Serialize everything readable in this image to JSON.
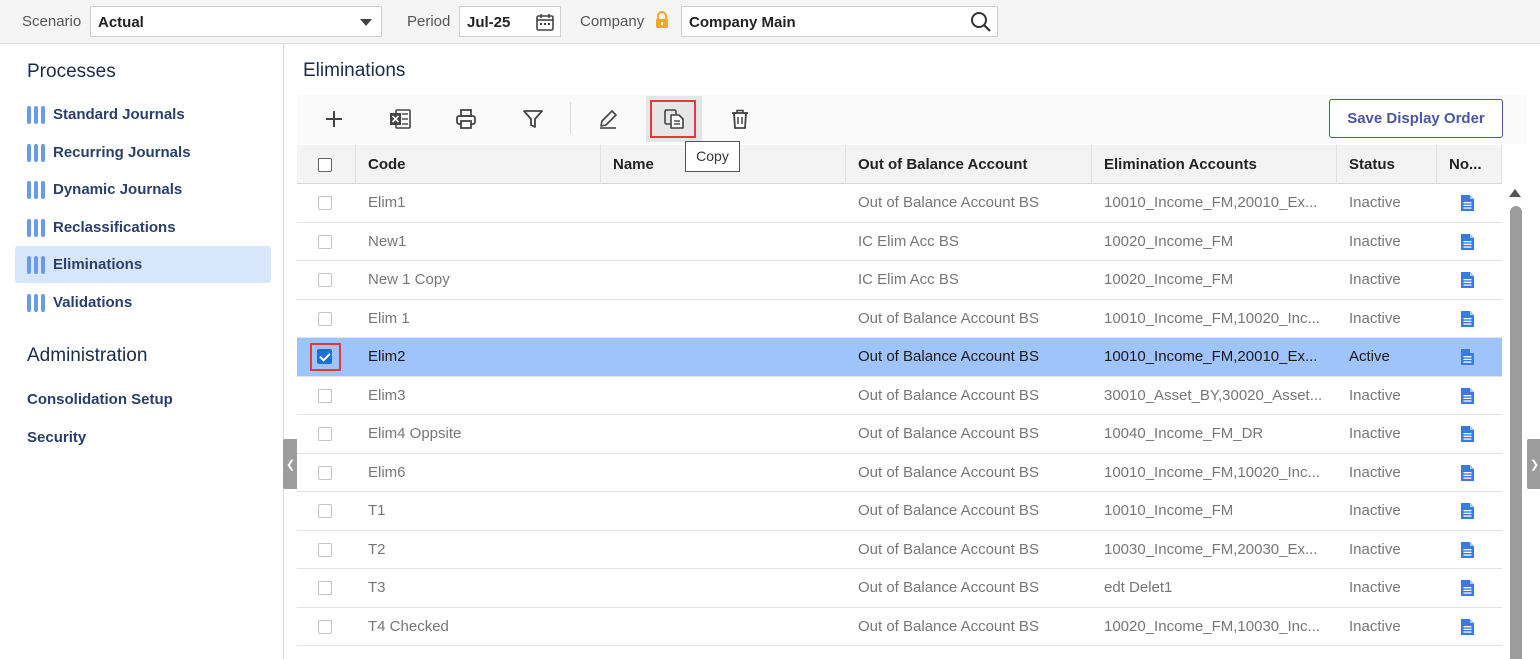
{
  "topbar": {
    "scenario_label": "Scenario",
    "scenario_value": "Actual",
    "period_label": "Period",
    "period_value": "Jul-25",
    "company_label": "Company",
    "company_value": "Company Main"
  },
  "sidebar": {
    "processes_heading": "Processes",
    "processes": [
      {
        "label": "Standard Journals"
      },
      {
        "label": "Recurring Journals"
      },
      {
        "label": "Dynamic Journals"
      },
      {
        "label": "Reclassifications"
      },
      {
        "label": "Eliminations"
      },
      {
        "label": "Validations"
      }
    ],
    "active_process": "Eliminations",
    "administration_heading": "Administration",
    "admin_links": [
      {
        "label": "Consolidation Setup"
      },
      {
        "label": "Security"
      }
    ]
  },
  "main": {
    "title": "Eliminations",
    "save_display_order_label": "Save Display Order",
    "tooltip": "Copy",
    "toolbar_icons": [
      "plus-icon",
      "excel-icon",
      "print-icon",
      "filter-icon",
      "edit-icon",
      "copy-icon",
      "delete-icon"
    ]
  },
  "grid": {
    "columns": [
      "Code",
      "Name",
      "Out of Balance Account",
      "Elimination Accounts",
      "Status",
      "No..."
    ],
    "rows": [
      {
        "code": "Elim1",
        "name": "",
        "oob": "Out of Balance Account BS",
        "accounts": "10010_Income_FM,20010_Ex...",
        "status": "Inactive",
        "checked": false
      },
      {
        "code": "New1",
        "name": "",
        "oob": "IC Elim Acc BS",
        "accounts": "10020_Income_FM",
        "status": "Inactive",
        "checked": false
      },
      {
        "code": "New 1 Copy",
        "name": "",
        "oob": "IC Elim Acc BS",
        "accounts": "10020_Income_FM",
        "status": "Inactive",
        "checked": false
      },
      {
        "code": "Elim 1",
        "name": "",
        "oob": "Out of Balance Account BS",
        "accounts": "10010_Income_FM,10020_Inc...",
        "status": "Inactive",
        "checked": false
      },
      {
        "code": "Elim2",
        "name": "",
        "oob": "Out of Balance Account BS",
        "accounts": "10010_Income_FM,20010_Ex...",
        "status": "Active",
        "checked": true
      },
      {
        "code": "Elim3",
        "name": "",
        "oob": "Out of Balance Account BS",
        "accounts": "30010_Asset_BY,30020_Asset...",
        "status": "Inactive",
        "checked": false
      },
      {
        "code": "Elim4 Oppsite",
        "name": "",
        "oob": "Out of Balance Account BS",
        "accounts": "10040_Income_FM_DR",
        "status": "Inactive",
        "checked": false
      },
      {
        "code": "Elim6",
        "name": "",
        "oob": "Out of Balance Account BS",
        "accounts": "10010_Income_FM,10020_Inc...",
        "status": "Inactive",
        "checked": false
      },
      {
        "code": "T1",
        "name": "",
        "oob": "Out of Balance Account BS",
        "accounts": "10010_Income_FM",
        "status": "Inactive",
        "checked": false
      },
      {
        "code": "T2",
        "name": "",
        "oob": "Out of Balance Account BS",
        "accounts": "10030_Income_FM,20030_Ex...",
        "status": "Inactive",
        "checked": false
      },
      {
        "code": "T3",
        "name": "",
        "oob": "Out of Balance Account BS",
        "accounts": "edt Delet1",
        "status": "Inactive",
        "checked": false
      },
      {
        "code": "T4 Checked",
        "name": "",
        "oob": "Out of Balance Account BS",
        "accounts": "10020_Income_FM,10030_Inc...",
        "status": "Inactive",
        "checked": false
      }
    ]
  },
  "colors": {
    "accent": "#4a56a6",
    "selected_row": "#9fc3fb",
    "active_nav": "#d8e6fb",
    "highlight_red": "#e03a3a",
    "lock_orange": "#f5a623",
    "doc_blue": "#3a7be0"
  }
}
